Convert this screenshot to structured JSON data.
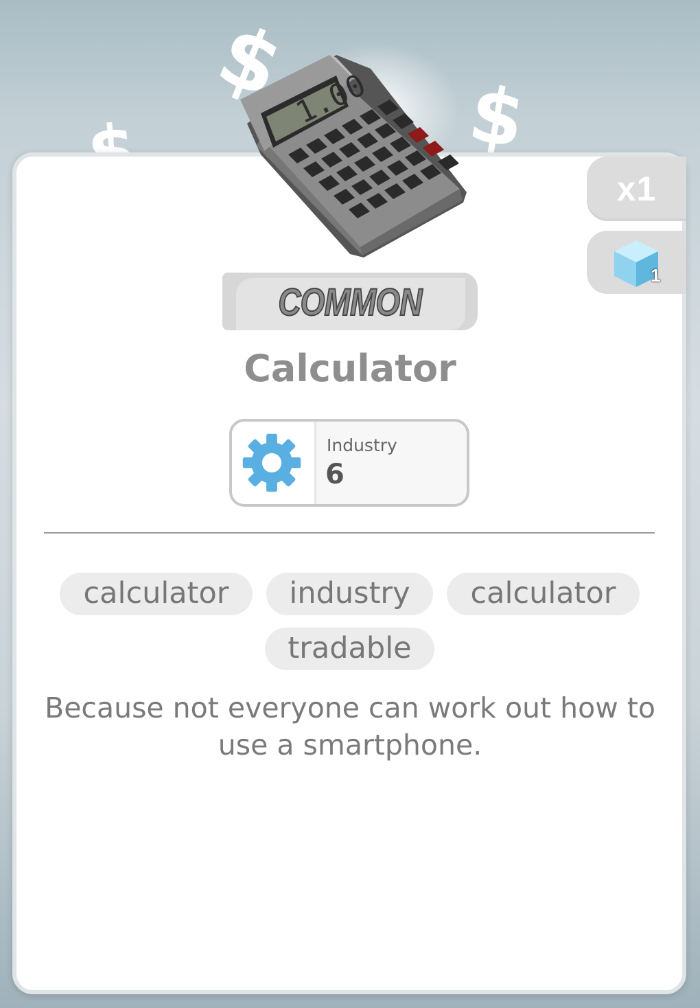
{
  "item": {
    "rarity": "COMMON",
    "name": "Calculator",
    "quantity": "x1",
    "cube_count": "1",
    "calculator_display": "1.00",
    "stat": {
      "label": "Industry",
      "value": "6",
      "icon": "gear-icon"
    },
    "tags": [
      "calculator",
      "industry",
      "calculator",
      "tradable"
    ],
    "description": "Because not everyone can work out how to use a smartphone."
  },
  "colors": {
    "gear": "#5aafe2",
    "cube": "#8fd3ef",
    "rarity_text": "#8a8a8a",
    "name_text": "#8e8e8e"
  }
}
